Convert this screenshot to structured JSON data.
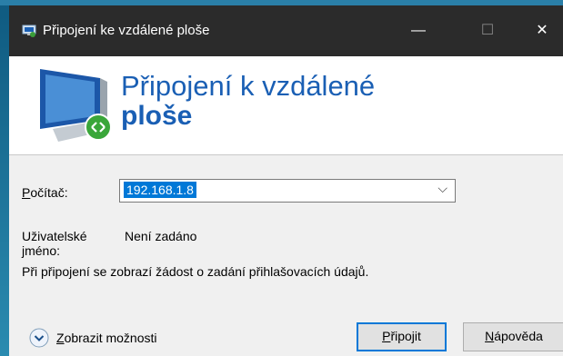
{
  "window": {
    "title": "Připojení ke vzdálené ploše",
    "minimize_glyph": "—",
    "maximize_glyph": "☐",
    "close_glyph": "✕"
  },
  "banner": {
    "line1": "Připojení k vzdálené",
    "line2": "ploše"
  },
  "form": {
    "computer_label_accel": "P",
    "computer_label_rest": "očítač:",
    "computer_value": "192.168.1.8",
    "username_label": "Uživatelské jméno:",
    "username_value": "Není zadáno",
    "note": "Při připojení se zobrazí žádost o zadání přihlašovacích údajů."
  },
  "footer": {
    "options_accel": "Z",
    "options_rest": "obrazit možnosti",
    "connect_accel": "P",
    "connect_rest": "řipojit",
    "help_accel": "N",
    "help_rest": "ápověda"
  },
  "colors": {
    "accent": "#0078d7",
    "heading": "#1a5fb4",
    "titlebar": "#2b2b2b"
  }
}
